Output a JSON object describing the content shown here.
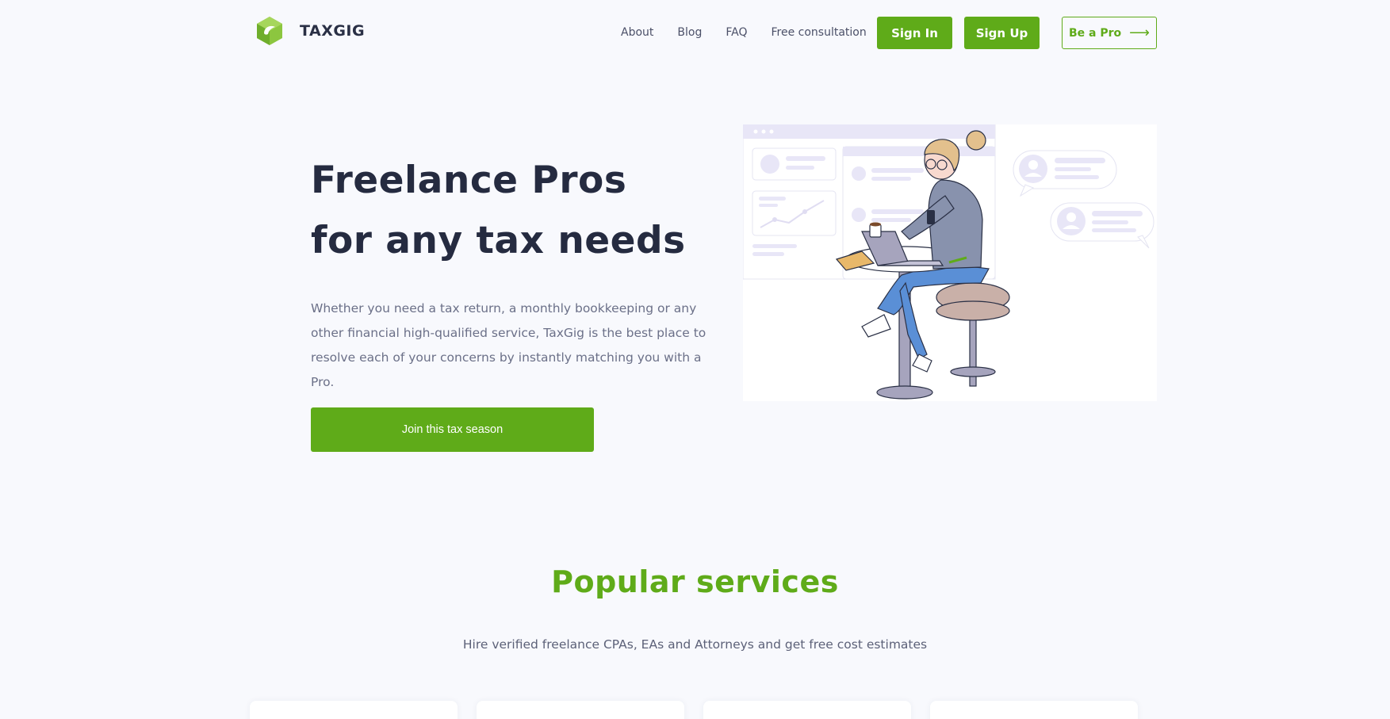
{
  "brand": {
    "name": "TAXGIG",
    "accent": "#5fab19",
    "dark": "#252b40"
  },
  "nav": {
    "items": [
      {
        "label": "About"
      },
      {
        "label": "Blog"
      },
      {
        "label": "FAQ"
      },
      {
        "label": "Free consultation"
      }
    ],
    "signin_label": "Sign In",
    "signup_label": "Sign Up",
    "pro_label": "Be a Pro",
    "pro_icon": "arrow-right-icon"
  },
  "hero": {
    "title": "Freelance Pros for any tax needs",
    "text": "Whether you need a tax return, a monthly bookkeeping or any other financial high-qualified service, TaxGig is the best place to resolve each of your concerns by instantly matching you with a Pro.",
    "cta_label": "Join this tax season"
  },
  "services": {
    "title": "Popular services",
    "subtitle": "Hire verified freelance CPAs, EAs and Attorneys and get free cost estimates"
  }
}
